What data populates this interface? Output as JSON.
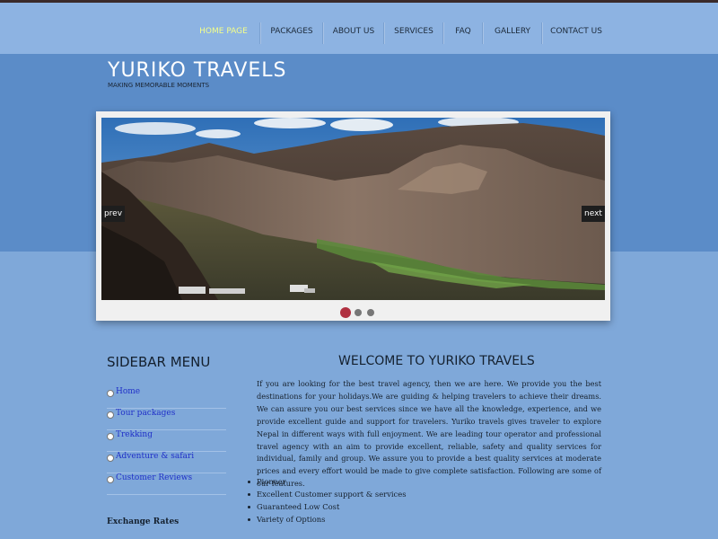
{
  "colors": {
    "nav_bg": "#8db3e2",
    "band_bg": "#5b8cc8",
    "page_bg": "#7fa8d9",
    "active_nav": "#f4ff8a",
    "active_dot": "#b03040",
    "link": "#2030c8"
  },
  "nav": {
    "items": [
      {
        "label": "HOME PAGE",
        "active": true
      },
      {
        "label": "PACKAGES"
      },
      {
        "label": "ABOUT US"
      },
      {
        "label": "SERVICES"
      },
      {
        "label": "FAQ"
      },
      {
        "label": "GALLERY"
      },
      {
        "label": "CONTACT US"
      }
    ]
  },
  "header": {
    "title": "YURIKO TRAVELS",
    "tagline": "MAKING MEMORABLE MOMENTS"
  },
  "slider": {
    "prev": "prev",
    "next": "next",
    "dots": 3,
    "active_dot": 1
  },
  "sidebar": {
    "title": "SIDEBAR MENU",
    "items": [
      {
        "label": "Home"
      },
      {
        "label": "Tour packages"
      },
      {
        "label": "Trekking"
      },
      {
        "label": "Adventure & safari"
      },
      {
        "label": "Customer Reviews"
      }
    ],
    "exchange_title": "Exchange Rates"
  },
  "main": {
    "title": "WELCOME TO YURIKO TRAVELS",
    "text": "If you are looking for the best travel agency, then we are here. We provide you the best destinations for your holidays.We are guiding & helping travelers to achieve their dreams. We can assure you our best services since we have all the knowledge, experience, and we provide excellent guide and support for travelers. Yuriko travels  gives traveler to explore Nepal in different ways with full enjoyment. We are leading tour operator and professional travel agency with an aim to provide excellent, reliable, safety and quality services for individual, family and group. We assure you to provide a best quality services at moderate prices and every effort would be made to give complete satisfaction. Following are some of our features.",
    "features": [
      "Pioneer",
      "Excellent Customer support & services",
      "Guaranteed Low Cost",
      "Variety of Options"
    ]
  }
}
